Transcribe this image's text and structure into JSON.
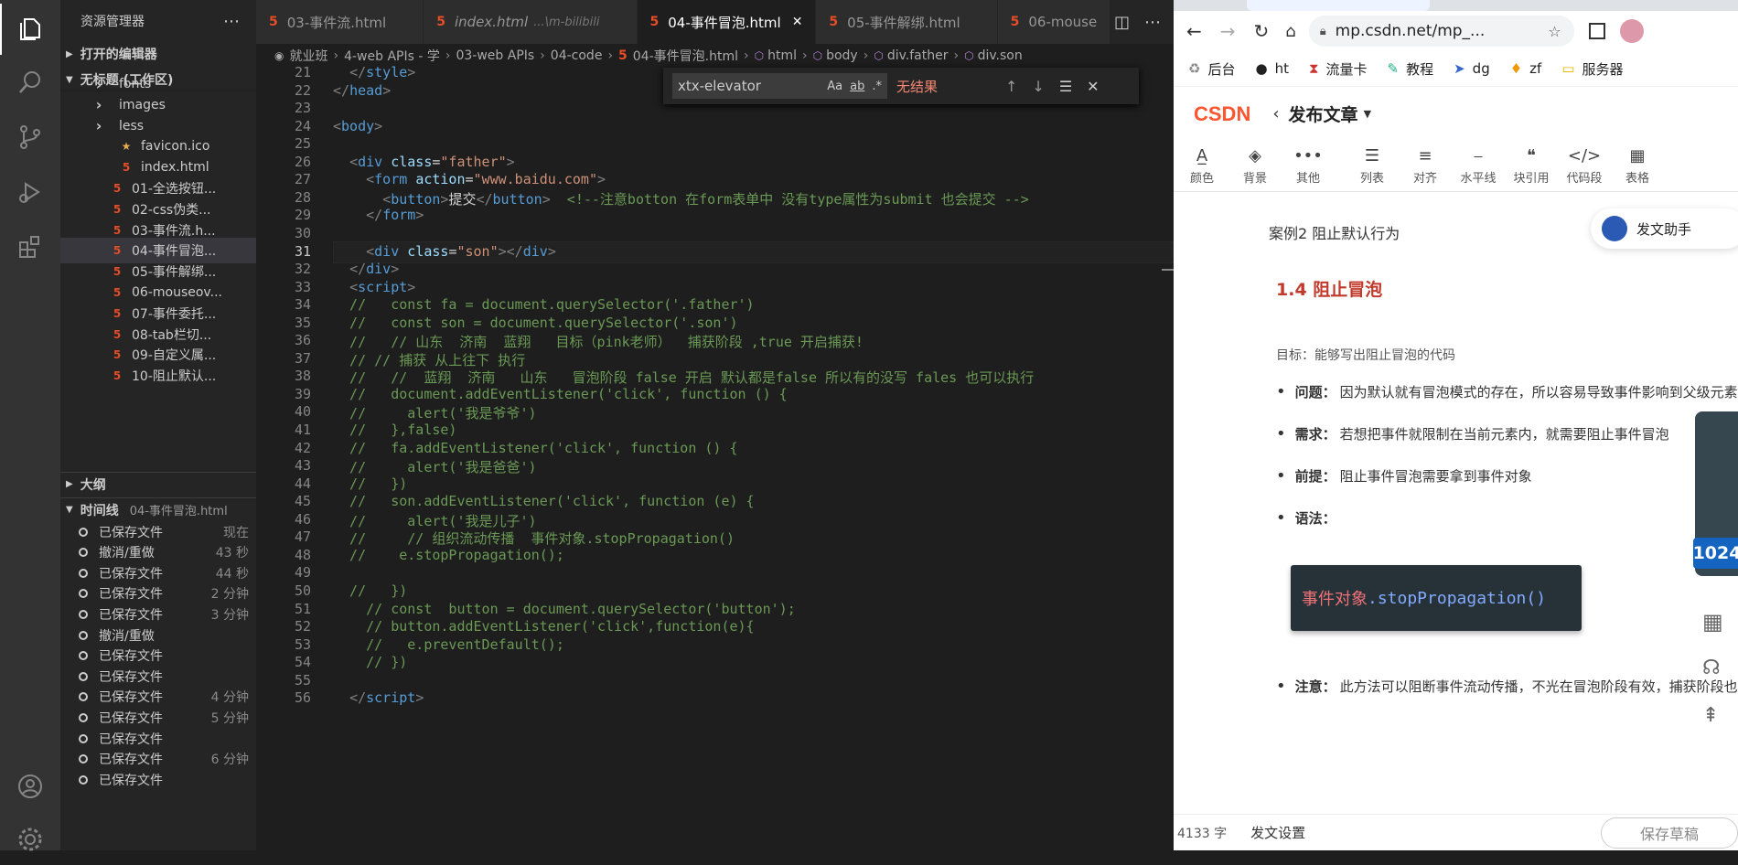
{
  "sidebar": {
    "title": "资源管理器",
    "open_editors": "打开的编辑器",
    "workspace": "无标题 (工作区)",
    "files": [
      "fonts",
      "images",
      "less",
      "favicon.ico",
      "index.html",
      "01-全选按钮...",
      "02-css伪类...",
      "03-事件流.h...",
      "04-事件冒泡...",
      "05-事件解绑...",
      "06-mouseov...",
      "07-事件委托...",
      "08-tab栏切...",
      "09-自定义属...",
      "10-阻止默认..."
    ],
    "outline": "大纲",
    "timeline": "时间线",
    "timeline_file": "04-事件冒泡.html",
    "timeline_items": [
      {
        "label": "已保存文件",
        "time": "现在"
      },
      {
        "label": "撤消/重做",
        "time": "43 秒"
      },
      {
        "label": "已保存文件",
        "time": "44 秒"
      },
      {
        "label": "已保存文件",
        "time": "2 分钟"
      },
      {
        "label": "已保存文件",
        "time": "3 分钟"
      },
      {
        "label": "撤消/重做",
        "time": ""
      },
      {
        "label": "已保存文件",
        "time": ""
      },
      {
        "label": "已保存文件",
        "time": ""
      },
      {
        "label": "已保存文件",
        "time": "4 分钟"
      },
      {
        "label": "已保存文件",
        "time": "5 分钟"
      },
      {
        "label": "已保存文件",
        "time": ""
      },
      {
        "label": "已保存文件",
        "time": "6 分钟"
      },
      {
        "label": "已保存文件",
        "time": ""
      }
    ]
  },
  "tabs": [
    {
      "label": "03-事件流.html",
      "suffix": "",
      "active": false
    },
    {
      "label": "index.html",
      "suffix": "...\\m-bilibili",
      "active": false
    },
    {
      "label": "04-事件冒泡.html",
      "suffix": "",
      "active": true
    },
    {
      "label": "05-事件解绑.html",
      "suffix": "",
      "active": false
    },
    {
      "label": "06-mouse",
      "suffix": "",
      "active": false
    }
  ],
  "breadcrumb": [
    "就业班",
    "4-web APIs - 学",
    "03-web APIs",
    "04-code",
    "04-事件冒泡.html",
    "html",
    "body",
    "div.father",
    "div.son"
  ],
  "find": {
    "query": "xtx-elevator",
    "result": "无结果",
    "opt_case": "Aa",
    "opt_word": "ab",
    "opt_regex": ".*"
  },
  "editor": {
    "current_line": 31,
    "lines": [
      {
        "n": 21,
        "html": "  <span class=\"tg\">&lt;/</span><span class=\"tn\">style</span><span class=\"tg\">&gt;</span>"
      },
      {
        "n": 22,
        "html": "<span class=\"tg\">&lt;/</span><span class=\"tn\">head</span><span class=\"tg\">&gt;</span>"
      },
      {
        "n": 23,
        "html": ""
      },
      {
        "n": 24,
        "html": "<span class=\"tg\">&lt;</span><span class=\"tn\">body</span><span class=\"tg\">&gt;</span>"
      },
      {
        "n": 25,
        "html": ""
      },
      {
        "n": 26,
        "html": "  <span class=\"tg\">&lt;</span><span class=\"tn\">div</span> <span class=\"at\">class</span>=<span class=\"sv\">\"father\"</span><span class=\"tg\">&gt;</span>"
      },
      {
        "n": 27,
        "html": "    <span class=\"tg\">&lt;</span><span class=\"tn\">form</span> <span class=\"at\">action</span>=<span class=\"sv\">\"www.baidu.com\"</span><span class=\"tg\">&gt;</span>"
      },
      {
        "n": 28,
        "html": "      <span class=\"tg\">&lt;</span><span class=\"tn\">button</span><span class=\"tg\">&gt;</span>提交<span class=\"tg\">&lt;/</span><span class=\"tn\">button</span><span class=\"tg\">&gt;</span>  <span class=\"cm\">&lt;!--注意botton 在form表单中 没有type属性为submit 也会提交 --&gt;</span>"
      },
      {
        "n": 29,
        "html": "    <span class=\"tg\">&lt;/</span><span class=\"tn\">form</span><span class=\"tg\">&gt;</span>"
      },
      {
        "n": 30,
        "html": ""
      },
      {
        "n": 31,
        "html": "    <span class=\"tg\">&lt;</span><span class=\"tn\">div</span> <span class=\"at\">class</span>=<span class=\"sv\">\"son\"</span><span class=\"tg\">&gt;&lt;/</span><span class=\"tn\">div</span><span class=\"tg\">&gt;</span>"
      },
      {
        "n": 32,
        "html": "  <span class=\"tg\">&lt;/</span><span class=\"tn\">div</span><span class=\"tg\">&gt;</span>"
      },
      {
        "n": 33,
        "html": "  <span class=\"tg\">&lt;</span><span class=\"tn\">script</span><span class=\"tg\">&gt;</span>"
      },
      {
        "n": 34,
        "html": "<span class=\"cm\">  //   const fa = document.querySelector('.father')</span>"
      },
      {
        "n": 35,
        "html": "<span class=\"cm\">  //   const son = document.querySelector('.son')</span>"
      },
      {
        "n": 36,
        "html": "<span class=\"cm\">  //   // 山东  济南  蓝翔   目标（pink老师）  捕获阶段 ,true 开启捕获!</span>"
      },
      {
        "n": 37,
        "html": "<span class=\"cm\">  // // 捕获 从上往下 执行</span>"
      },
      {
        "n": 38,
        "html": "<span class=\"cm\">  //   //  蓝翔  济南   山东   冒泡阶段 false 开启 默认都是false 所以有的没写 fales 也可以执行</span>"
      },
      {
        "n": 39,
        "html": "<span class=\"cm\">  //   document.addEventListener('click', function () {</span>"
      },
      {
        "n": 40,
        "html": "<span class=\"cm\">  //     alert('我是爷爷')</span>"
      },
      {
        "n": 41,
        "html": "<span class=\"cm\">  //   },false)</span>"
      },
      {
        "n": 42,
        "html": "<span class=\"cm\">  //   fa.addEventListener('click', function () {</span>"
      },
      {
        "n": 43,
        "html": "<span class=\"cm\">  //     alert('我是爸爸')</span>"
      },
      {
        "n": 44,
        "html": "<span class=\"cm\">  //   })</span>"
      },
      {
        "n": 45,
        "html": "<span class=\"cm\">  //   son.addEventListener('click', function (e) {</span>"
      },
      {
        "n": 46,
        "html": "<span class=\"cm\">  //     alert('我是儿子')</span>"
      },
      {
        "n": 47,
        "html": "<span class=\"cm\">  //     // 组织流动传播  事件对象.stopPropagation()</span>"
      },
      {
        "n": 48,
        "html": "<span class=\"cm\">  //    e.stopPropagation();</span>"
      },
      {
        "n": 49,
        "html": ""
      },
      {
        "n": 50,
        "html": "<span class=\"cm\">  //   })</span>"
      },
      {
        "n": 51,
        "html": "<span class=\"cm\">    // const  button = document.querySelector('button');</span>"
      },
      {
        "n": 52,
        "html": "<span class=\"cm\">    // button.addEventListener('click',function(e){</span>"
      },
      {
        "n": 53,
        "html": "<span class=\"cm\">    //   e.preventDefault();</span>"
      },
      {
        "n": 54,
        "html": "<span class=\"cm\">    // })</span>"
      },
      {
        "n": 55,
        "html": ""
      },
      {
        "n": 56,
        "html": "  <span class=\"tg\">&lt;/</span><span class=\"tn\">script</span><span class=\"tg\">&gt;</span>"
      }
    ]
  },
  "browser": {
    "url": "mp.csdn.net/mp_...",
    "bookmarks": [
      "后台",
      "ht",
      "流量卡",
      "教程",
      "dg",
      "zf",
      "服务器"
    ],
    "logo": "CSDN",
    "page_title": "发布文章",
    "toolbar": [
      "颜色",
      "背景",
      "其他",
      "列表",
      "对齐",
      "水平线",
      "块引用",
      "代码段",
      "表格"
    ],
    "case_title": "案例2   阻止默认行为",
    "assistant": "发文助手",
    "section_title": "1.4 阻止冒泡",
    "goal": "目标：能够写出阻止冒泡的代码",
    "items": [
      {
        "k": "问题：",
        "v": "因为默认就有冒泡模式的存在，所以容易导致事件影响到父级元素"
      },
      {
        "k": "需求：",
        "v": "若想把事件就限制在当前元素内，就需要阻止事件冒泡"
      },
      {
        "k": "前提：",
        "v": "阻止事件冒泡需要拿到事件对象"
      },
      {
        "k": "语法：",
        "v": ""
      }
    ],
    "code_prefix": "事件对象",
    "code_method": ".stopPropagation()",
    "note_k": "注意：",
    "note_v": "此方法可以阻断事件流动传播，不光在冒泡阶段有效，捕获阶段也有...",
    "word_count": "4133 字",
    "settings": "发文设置",
    "save_draft": "保存草稿",
    "badge": "1024"
  }
}
